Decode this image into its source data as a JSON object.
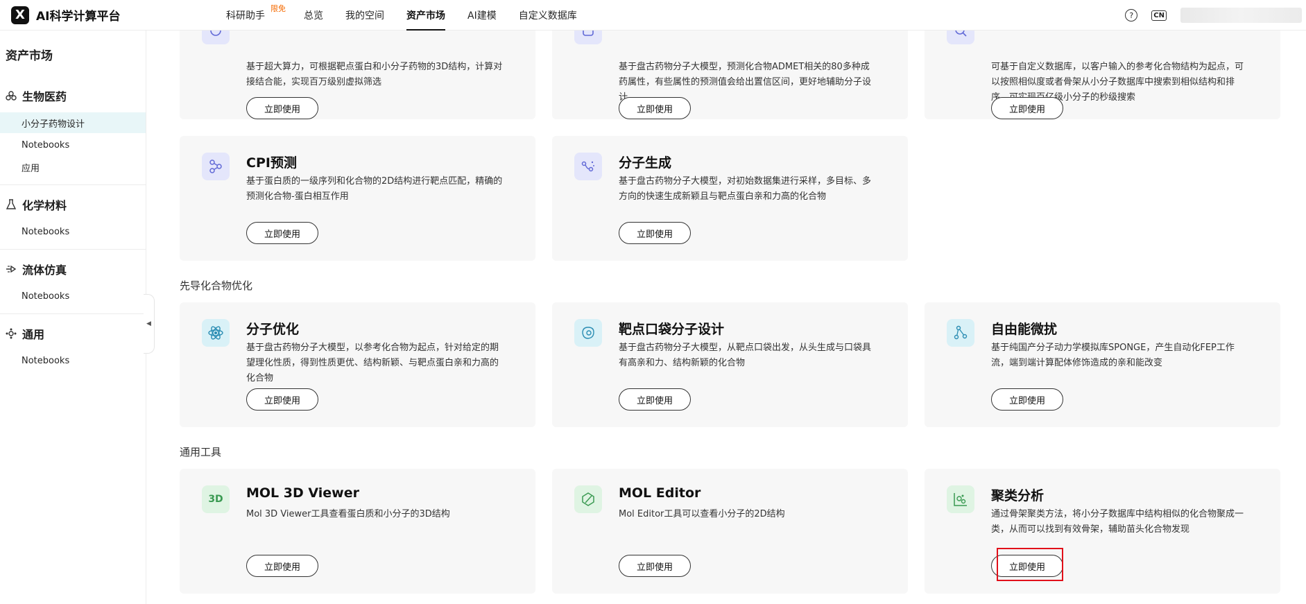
{
  "app": {
    "logo_mark": "X",
    "title": "AI科学计算平台"
  },
  "nav": [
    {
      "label": "科研助手",
      "badge": "限免"
    },
    {
      "label": "总览"
    },
    {
      "label": "我的空间"
    },
    {
      "label": "资产市场",
      "active": true
    },
    {
      "label": "AI建模"
    },
    {
      "label": "自定义数据库"
    }
  ],
  "topright": {
    "help": "?",
    "lang": "CN"
  },
  "sidebar": {
    "title": "资产市场",
    "groups": [
      {
        "name": "生物医药",
        "icon": "molecule-icon",
        "items": [
          "小分子药物设计",
          "Notebooks",
          "应用"
        ]
      },
      {
        "name": "化学材料",
        "icon": "flask-icon",
        "items": [
          "Notebooks"
        ]
      },
      {
        "name": "流体仿真",
        "icon": "fluid-icon",
        "items": [
          "Notebooks"
        ]
      },
      {
        "name": "通用",
        "icon": "network-icon",
        "items": [
          "Notebooks"
        ]
      }
    ]
  },
  "cards_top": [
    {
      "desc": "基于超大算力，可根据靶点蛋白和小分子药物的3D结构，计算对接结合能，实现百万级别虚拟筛选",
      "btn": "立即使用"
    },
    {
      "desc": "基于盘古药物分子大模型，预测化合物ADMET相关的80多种成药属性，有些属性的预测值会给出置信区间，更好地辅助分子设计",
      "btn": "立即使用"
    },
    {
      "desc": "可基于自定义数据库，以客户输入的参考化合物结构为起点，可以按照相似度或者骨架从小分子数据库中搜索到相似结构和排序，可实现百亿级小分子的秒级搜索",
      "btn": "立即使用"
    }
  ],
  "cards_row2": [
    {
      "title": "CPI预测",
      "desc": "基于蛋白质的一级序列和化合物的2D结构进行靶点匹配，精确的预测化合物-蛋白相互作用",
      "btn": "立即使用",
      "icon": "cpi-icon"
    },
    {
      "title": "分子生成",
      "desc": "基于盘古药物分子大模型，对初始数据集进行采样，多目标、多方向的快速生成新颖且与靶点蛋白亲和力高的化合物",
      "btn": "立即使用",
      "icon": "generate-icon"
    }
  ],
  "section_lead": "先导化合物优化",
  "cards_row3": [
    {
      "title": "分子优化",
      "desc": "基于盘古药物分子大模型，以参考化合物为起点，针对给定的期望理化性质，得到性质更优、结构新颖、与靶点蛋白亲和力高的化合物",
      "btn": "立即使用",
      "icon": "atom-icon"
    },
    {
      "title": "靶点口袋分子设计",
      "desc": "基于盘古药物分子大模型，从靶点口袋出发，从头生成与口袋具有高亲和力、结构新颖的化合物",
      "btn": "立即使用",
      "icon": "pocket-icon"
    },
    {
      "title": "自由能微扰",
      "desc": "基于纯国产分子动力学模拟库SPONGE，产生自动化FEP工作流，端到端计算配体修饰造成的亲和能改变",
      "btn": "立即使用",
      "icon": "fep-icon"
    }
  ],
  "section_tools": "通用工具",
  "cards_row4": [
    {
      "title": "MOL 3D Viewer",
      "desc": "Mol 3D Viewer工具查看蛋白质和小分子的3D结构",
      "btn": "立即使用",
      "icon": "3d-icon",
      "icon_text": "3D"
    },
    {
      "title": "MOL Editor",
      "desc": "Mol Editor工具可以查看小分子的2D结构",
      "btn": "立即使用",
      "icon": "editor-icon"
    },
    {
      "title": "聚类分析",
      "desc": "通过骨架聚类方法，将小分子数据库中结构相似的化合物聚成一类，从而可以找到有效骨架，辅助苗头化合物发现",
      "btn": "立即使用",
      "icon": "cluster-icon"
    }
  ]
}
